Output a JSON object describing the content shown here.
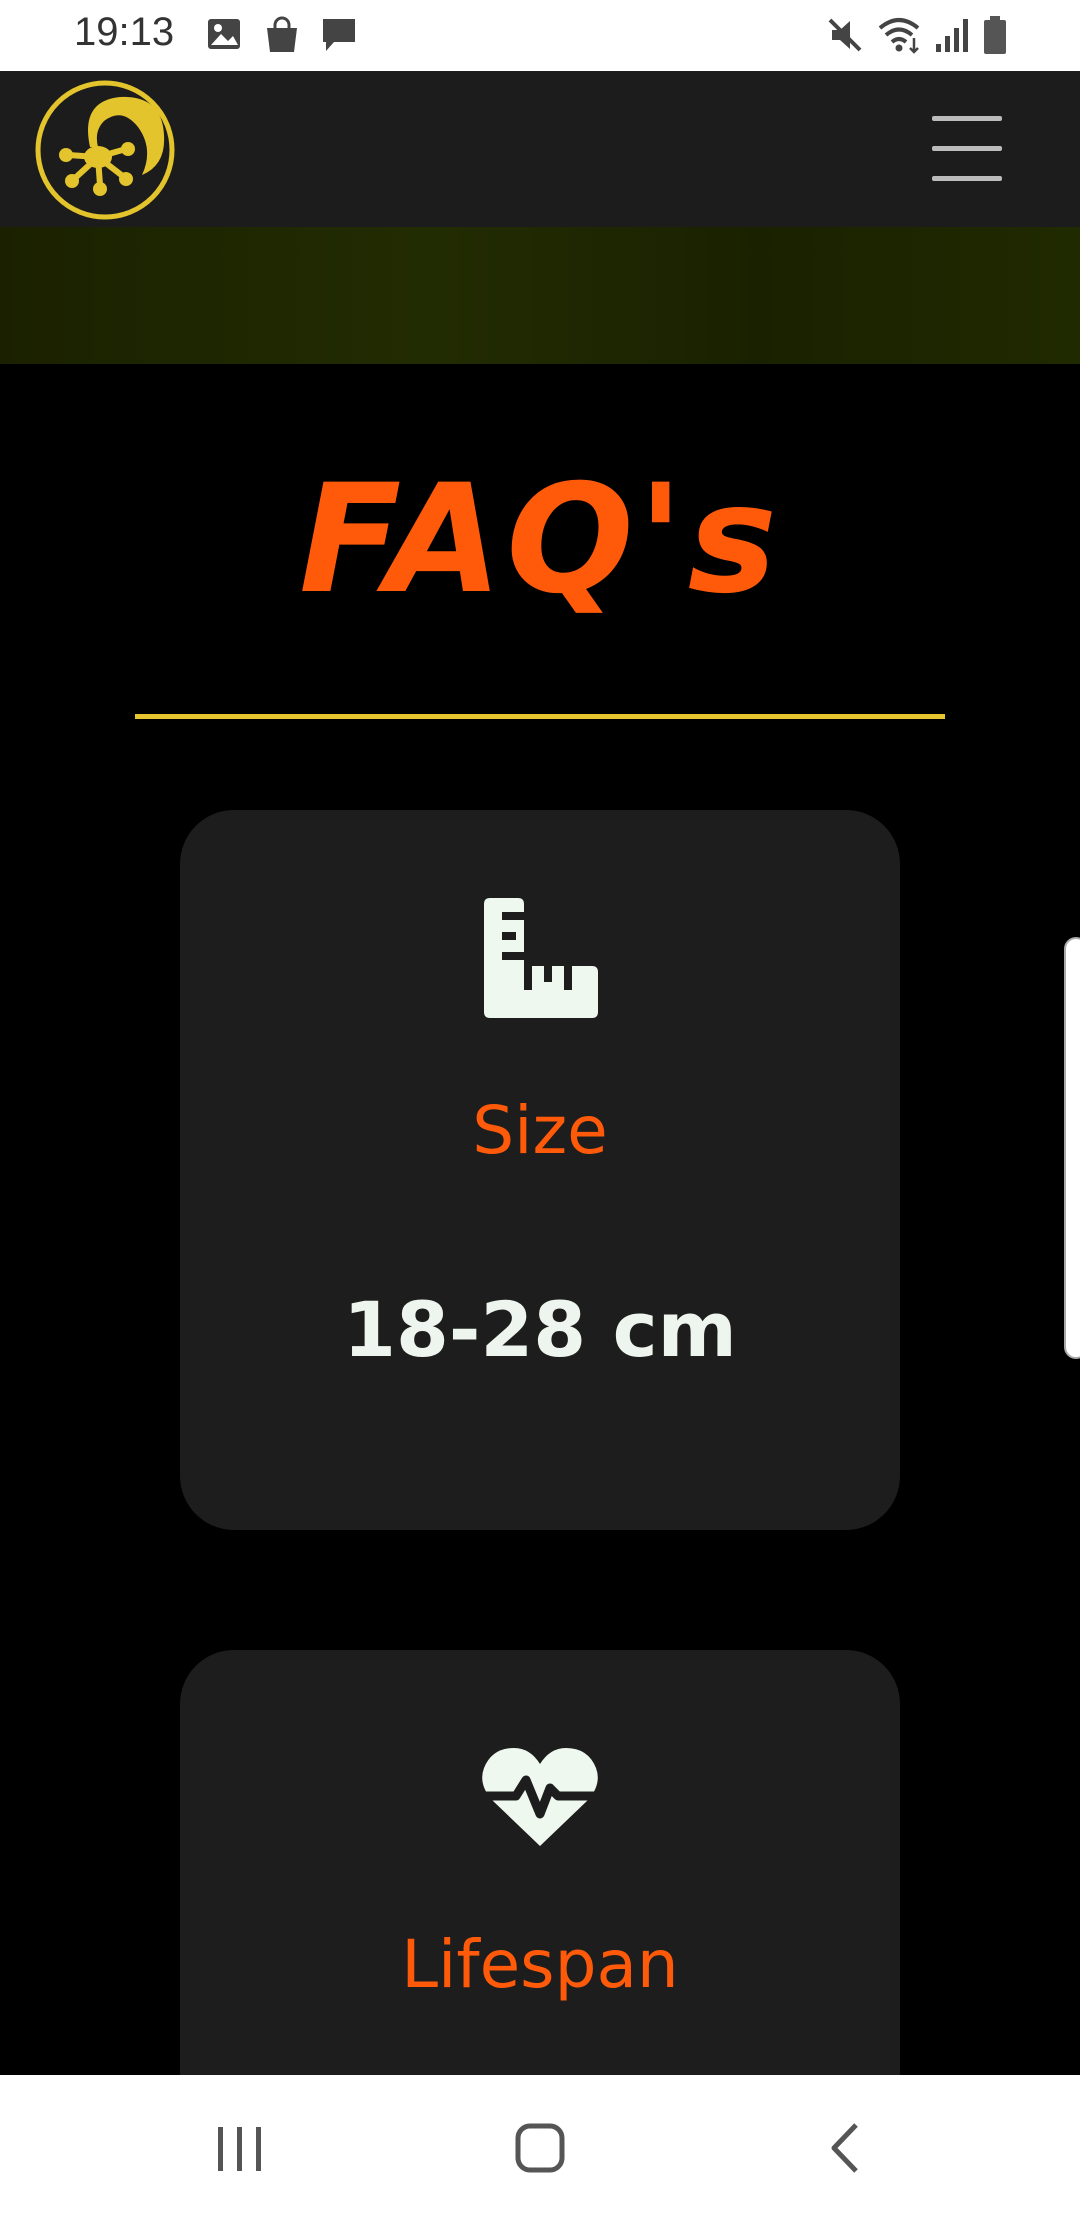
{
  "status_bar": {
    "time": "19:13",
    "left_icons": [
      "image-icon",
      "shopping-bag-icon",
      "message-icon"
    ],
    "right_icons": [
      "mute-icon",
      "wifi-icon",
      "signal-icon",
      "battery-icon"
    ]
  },
  "header": {
    "logo_icon": "gecko-logo-icon",
    "menu_icon": "hamburger-menu-icon"
  },
  "page": {
    "title": "FAQ's"
  },
  "cards": [
    {
      "icon": "ruler-icon",
      "label": "Size",
      "value": "18-28 cm"
    },
    {
      "icon": "heartbeat-icon",
      "label": "Lifespan"
    }
  ],
  "nav_bar": {
    "buttons": [
      "recent-apps-icon",
      "home-icon",
      "back-icon"
    ]
  },
  "colors": {
    "accent_orange": "#ff5a0a",
    "rule_yellow": "#e8c630",
    "logo_yellow": "#e3c42c",
    "card_bg": "#1d1d1d",
    "header_bg": "#1c1c1c"
  }
}
